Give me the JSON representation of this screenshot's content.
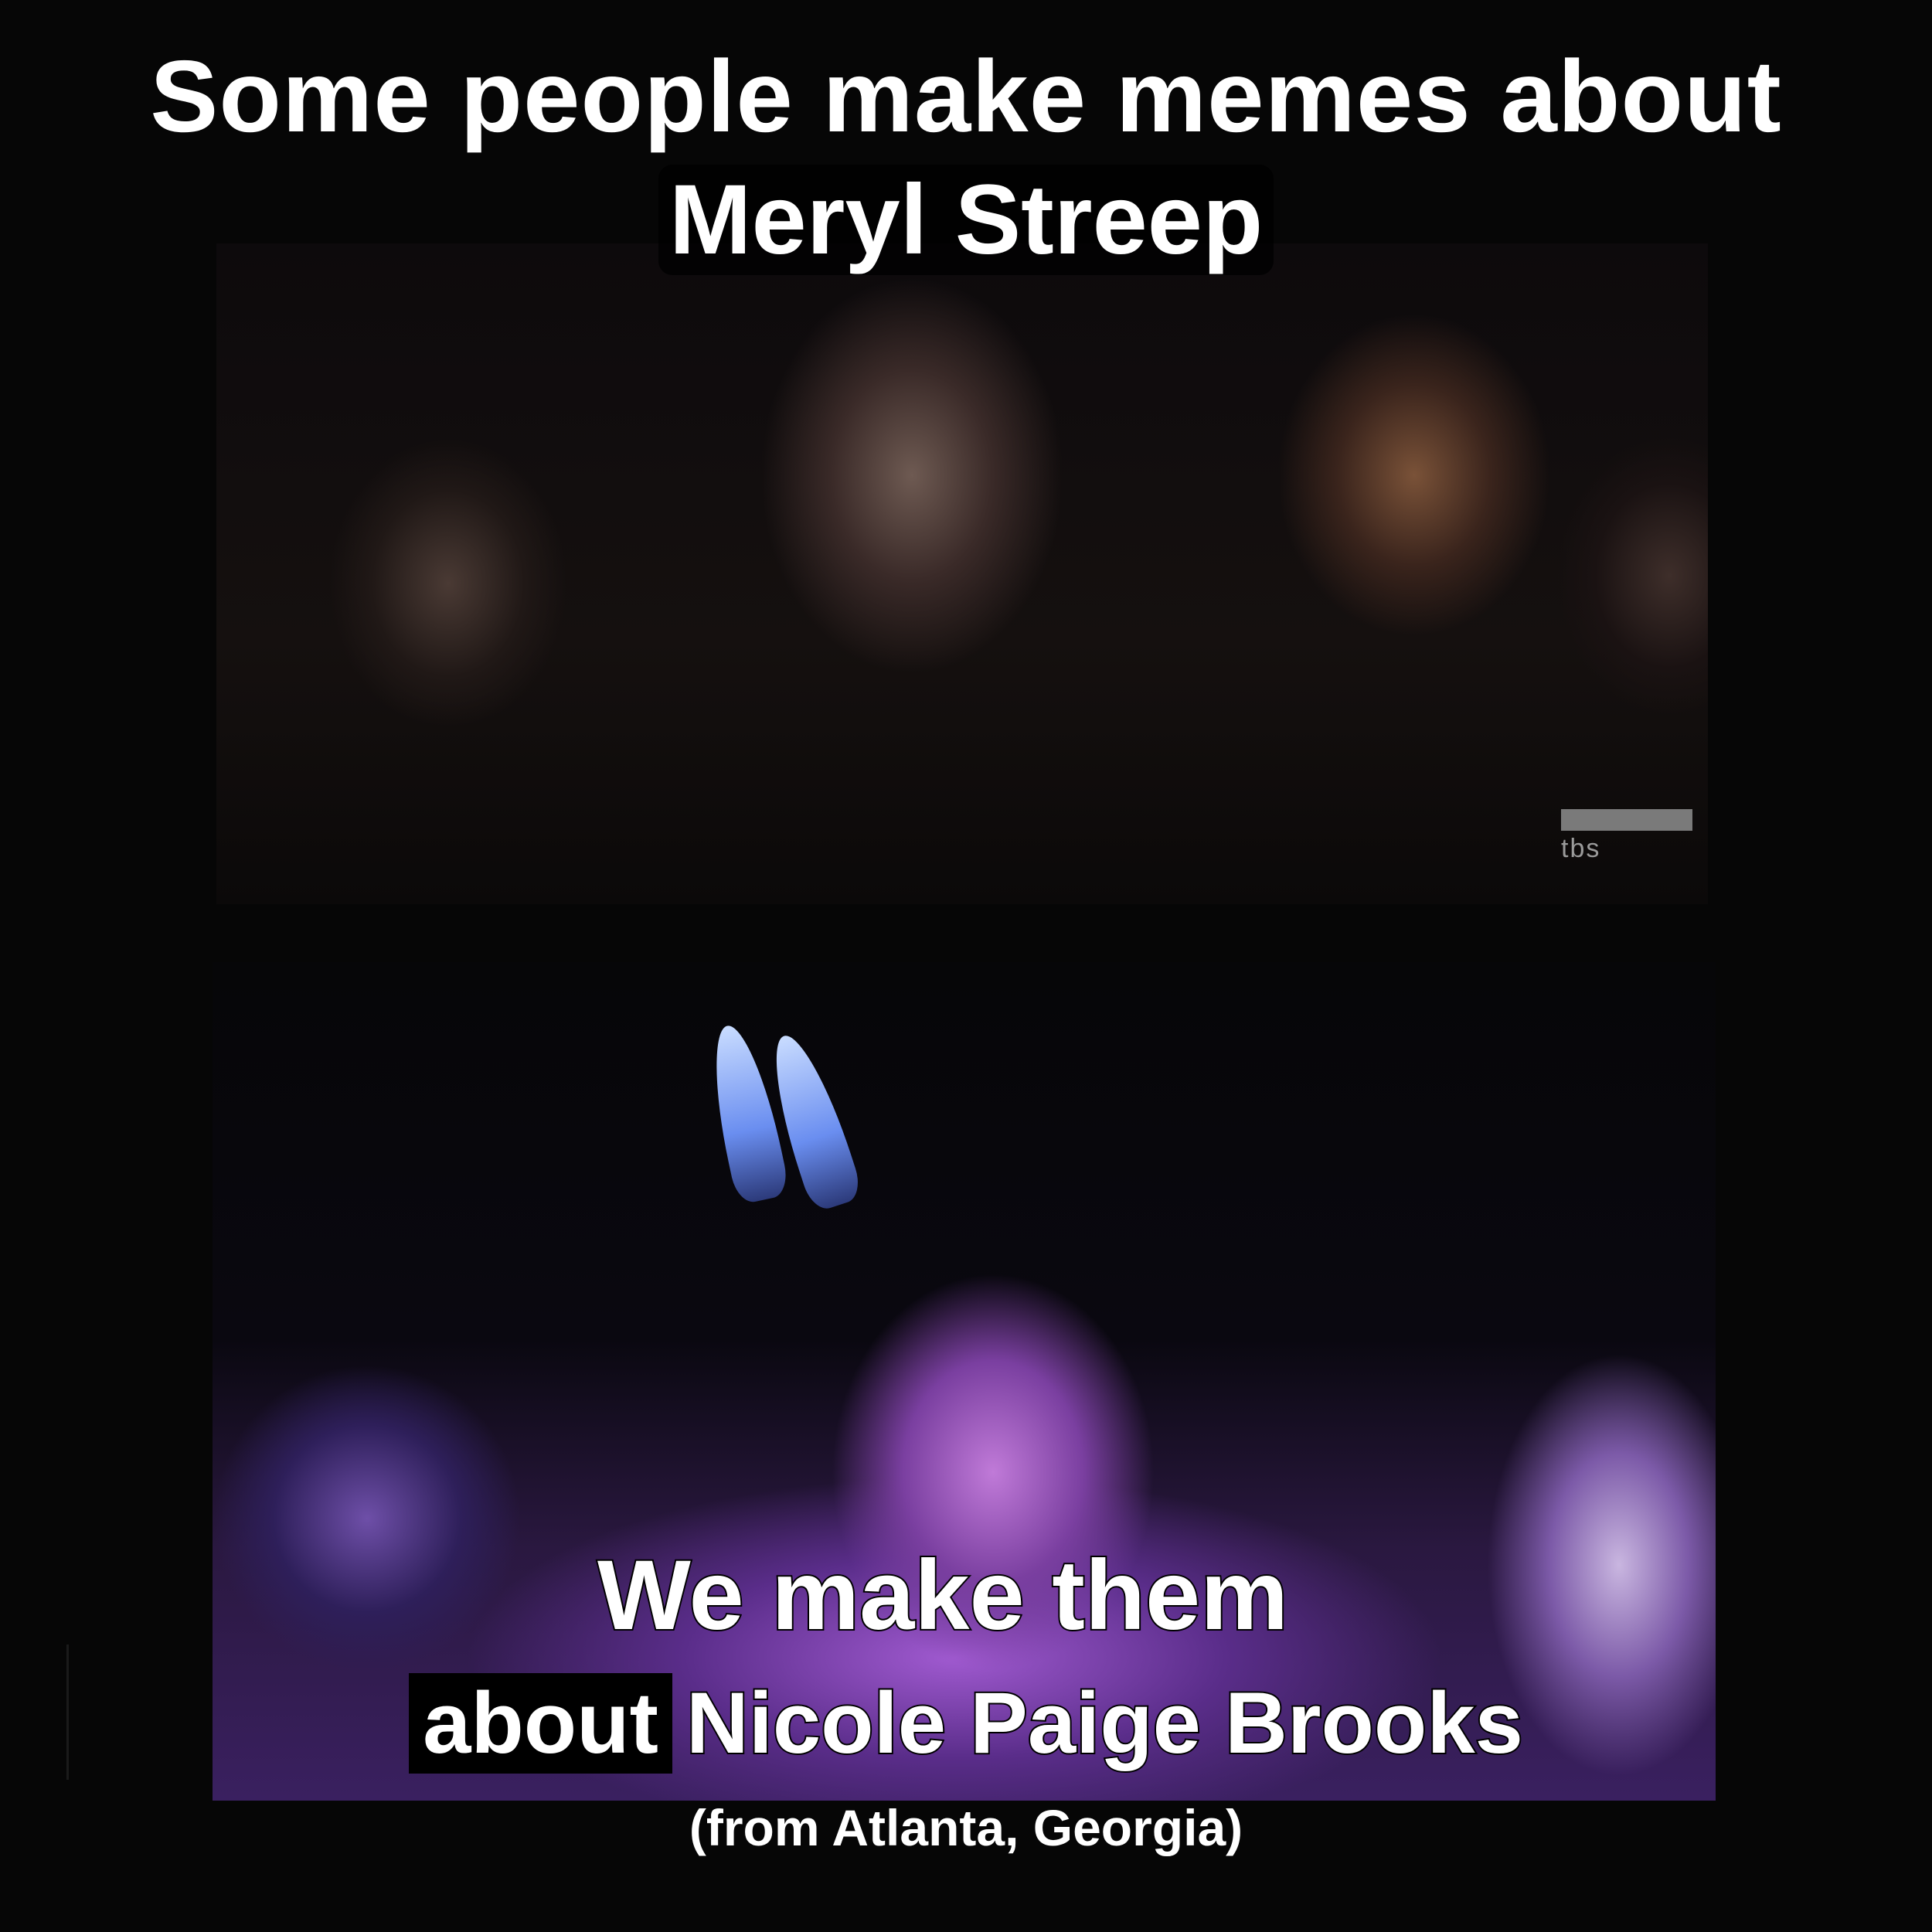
{
  "meme": {
    "top_line_1": "Some people make memes about",
    "top_line_2": "Meryl Streep",
    "bottom_line_1": "We make them",
    "bottom_line_2_prefix": "about",
    "bottom_line_2_name": "Nicole Paige Brooks",
    "bottom_line_3": "(from Atlanta, Georgia)"
  },
  "watermark": {
    "network": "tbs"
  },
  "colors": {
    "background": "#060606",
    "text": "#ffffff",
    "bottom_panel_tint": "#a05ad0"
  }
}
